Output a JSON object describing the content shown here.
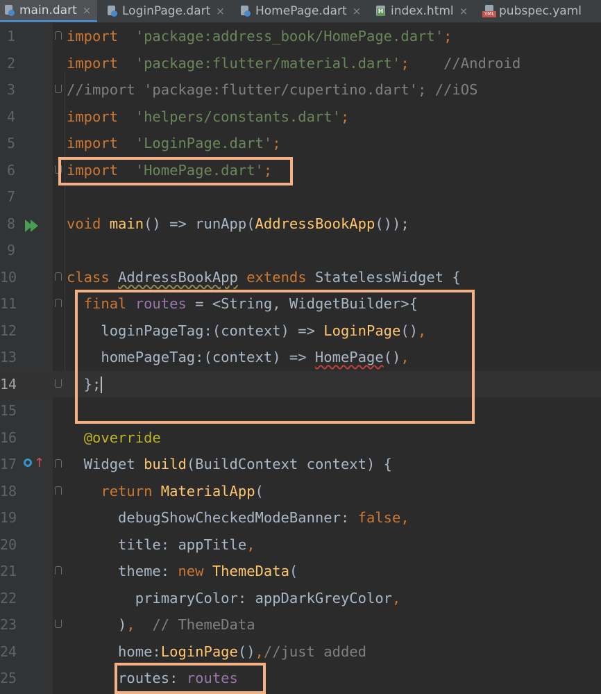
{
  "tabs": [
    {
      "label": "main.dart",
      "icon": "dart-file-icon",
      "active": true
    },
    {
      "label": "LoginPage.dart",
      "icon": "dart-file-icon"
    },
    {
      "label": "HomePage.dart",
      "icon": "dart-file-icon"
    },
    {
      "label": "index.html",
      "icon": "html-file-icon"
    },
    {
      "label": "pubspec.yaml",
      "icon": "yaml-file-icon"
    }
  ],
  "close_glyph": "×",
  "current_line": 14,
  "colors": {
    "highlight_box": "#f4b183",
    "keyword": "#cc7832",
    "string": "#6a8759",
    "function": "#ffc66d",
    "field": "#9876aa",
    "comment": "#808080",
    "annotation": "#bbb529",
    "background": "#2b2b2b"
  },
  "lines": [
    {
      "n": "1",
      "tokens": [
        [
          "kw",
          "import"
        ],
        [
          "",
          "  "
        ],
        [
          "str",
          "'package:address_book/HomePage.dart'"
        ],
        [
          "kw",
          ";"
        ]
      ]
    },
    {
      "n": "2",
      "tokens": [
        [
          "kw",
          "import"
        ],
        [
          "",
          "  "
        ],
        [
          "str",
          "'package:flutter/material.dart'"
        ],
        [
          "kw",
          ";"
        ],
        [
          "",
          "    "
        ],
        [
          "cmt",
          "//Android"
        ]
      ]
    },
    {
      "n": "3",
      "tokens": [
        [
          "cmt",
          "//import 'package:flutter/cupertino.dart'; //iOS"
        ]
      ]
    },
    {
      "n": "4",
      "tokens": [
        [
          "kw",
          "import"
        ],
        [
          "",
          "  "
        ],
        [
          "str",
          "'helpers/constants.dart'"
        ],
        [
          "kw",
          ";"
        ]
      ]
    },
    {
      "n": "5",
      "tokens": [
        [
          "kw",
          "import"
        ],
        [
          "",
          "  "
        ],
        [
          "str",
          "'LoginPage.dart'"
        ],
        [
          "kw",
          ";"
        ]
      ]
    },
    {
      "n": "6",
      "tokens": [
        [
          "kw",
          "import"
        ],
        [
          "",
          "  "
        ],
        [
          "str",
          "'HomePage.dart'"
        ],
        [
          "kw",
          ";"
        ]
      ]
    },
    {
      "n": "7",
      "tokens": []
    },
    {
      "n": "8",
      "tokens": [
        [
          "kw",
          "void"
        ],
        [
          "",
          " "
        ],
        [
          "fn",
          "main"
        ],
        [
          "",
          "() => runApp("
        ],
        [
          "fn",
          "AddressBookApp"
        ],
        [
          "",
          "());"
        ]
      ]
    },
    {
      "n": "9",
      "tokens": []
    },
    {
      "n": "10",
      "tokens": [
        [
          "kw",
          "class"
        ],
        [
          "",
          " "
        ],
        [
          "wavy",
          "AddressBookApp"
        ],
        [
          "",
          " "
        ],
        [
          "kw",
          "extends"
        ],
        [
          "",
          " StatelessWidget {"
        ]
      ]
    },
    {
      "n": "11",
      "tokens": [
        [
          "",
          "  "
        ],
        [
          "kw",
          "final"
        ],
        [
          "",
          " "
        ],
        [
          "fld",
          "routes"
        ],
        [
          "",
          " = <String, WidgetBuilder>{"
        ]
      ]
    },
    {
      "n": "12",
      "tokens": [
        [
          "",
          "    loginPageTag:(context) => "
        ],
        [
          "fn",
          "LoginPage"
        ],
        [
          "",
          "()"
        ],
        [
          "kw",
          ","
        ]
      ]
    },
    {
      "n": "13",
      "tokens": [
        [
          "",
          "    homePageTag:(context) => "
        ],
        [
          "wavy-red",
          "HomePage"
        ],
        [
          "",
          "()"
        ],
        [
          "kw",
          ","
        ]
      ]
    },
    {
      "n": "14",
      "tokens": [
        [
          "",
          "  };"
        ]
      ]
    },
    {
      "n": "15",
      "tokens": []
    },
    {
      "n": "16",
      "tokens": [
        [
          "",
          "  "
        ],
        [
          "ann",
          "@override"
        ]
      ]
    },
    {
      "n": "17",
      "tokens": [
        [
          "",
          "  Widget "
        ],
        [
          "fn",
          "build"
        ],
        [
          "",
          "(BuildContext context) {"
        ]
      ]
    },
    {
      "n": "18",
      "tokens": [
        [
          "",
          "    "
        ],
        [
          "kw",
          "return"
        ],
        [
          "",
          " "
        ],
        [
          "fn",
          "MaterialApp"
        ],
        [
          "",
          "("
        ]
      ]
    },
    {
      "n": "19",
      "tokens": [
        [
          "",
          "      debugShowCheckedModeBanner: "
        ],
        [
          "kw",
          "false,"
        ]
      ]
    },
    {
      "n": "20",
      "tokens": [
        [
          "",
          "      title: appTitle"
        ],
        [
          "kw",
          ","
        ]
      ]
    },
    {
      "n": "21",
      "tokens": [
        [
          "",
          "      theme: "
        ],
        [
          "kw",
          "new"
        ],
        [
          "",
          " "
        ],
        [
          "fn",
          "ThemeData"
        ],
        [
          "",
          "("
        ]
      ]
    },
    {
      "n": "22",
      "tokens": [
        [
          "",
          "        primaryColor: appDarkGreyColor"
        ],
        [
          "kw",
          ","
        ]
      ]
    },
    {
      "n": "23",
      "tokens": [
        [
          "",
          "      )"
        ],
        [
          "kw",
          ","
        ],
        [
          "",
          "  "
        ],
        [
          "cmt",
          "// ThemeData"
        ]
      ]
    },
    {
      "n": "24",
      "tokens": [
        [
          "",
          "      home:"
        ],
        [
          "fn",
          "LoginPage"
        ],
        [
          "",
          "()"
        ],
        [
          "kw",
          ","
        ],
        [
          "cmt",
          "//just added"
        ]
      ]
    },
    {
      "n": "25",
      "tokens": [
        [
          "",
          "      routes: "
        ],
        [
          "fld",
          "routes"
        ]
      ]
    }
  ]
}
